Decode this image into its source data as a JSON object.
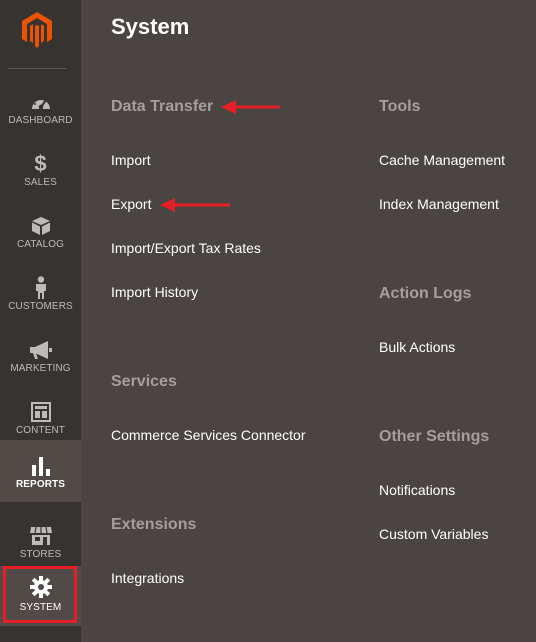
{
  "sidebar": {
    "items": [
      {
        "label": "DASHBOARD",
        "icon": "dashboard-icon"
      },
      {
        "label": "SALES",
        "icon": "dollar-icon"
      },
      {
        "label": "CATALOG",
        "icon": "box-icon"
      },
      {
        "label": "CUSTOMERS",
        "icon": "person-icon"
      },
      {
        "label": "MARKETING",
        "icon": "megaphone-icon"
      },
      {
        "label": "CONTENT",
        "icon": "layout-icon"
      },
      {
        "label": "REPORTS",
        "icon": "bar-chart-icon"
      },
      {
        "label": "STORES",
        "icon": "storefront-icon"
      },
      {
        "label": "SYSTEM",
        "icon": "gear-icon"
      }
    ],
    "active": "SYSTEM"
  },
  "page": {
    "title": "System"
  },
  "left_column": {
    "data_transfer": {
      "title": "Data Transfer",
      "links": [
        "Import",
        "Export",
        "Import/Export Tax Rates",
        "Import History"
      ]
    },
    "services": {
      "title": "Services",
      "links": [
        "Commerce Services Connector"
      ]
    },
    "extensions": {
      "title": "Extensions",
      "links": [
        "Integrations"
      ]
    }
  },
  "right_column": {
    "tools": {
      "title": "Tools",
      "links": [
        "Cache Management",
        "Index Management"
      ]
    },
    "action_logs": {
      "title": "Action Logs",
      "links": [
        "Bulk Actions"
      ]
    },
    "other_settings": {
      "title": "Other Settings",
      "links": [
        "Notifications",
        "Custom Variables"
      ]
    }
  },
  "colors": {
    "sidebar_bg": "#373330",
    "main_bg": "#4a4542",
    "accent": "#eb5202",
    "highlight": "#e61e25"
  }
}
